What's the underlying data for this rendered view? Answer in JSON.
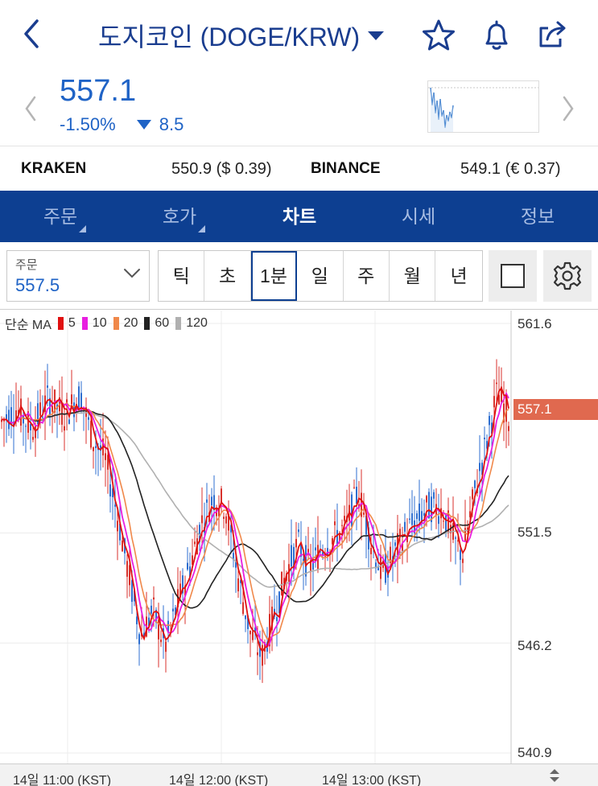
{
  "header": {
    "title": "도지코인 (DOGE/KRW)",
    "icons": [
      "back-arrow-icon",
      "star-icon",
      "bell-icon",
      "share-icon"
    ]
  },
  "price": {
    "current": "557.1",
    "change_pct": "-1.50%",
    "change_abs": "8.5",
    "color": "#1f63c6"
  },
  "exchanges": [
    {
      "name": "KRAKEN",
      "value": "550.9 ($ 0.39)"
    },
    {
      "name": "BINANCE",
      "value": "549.1 (€ 0.37)"
    }
  ],
  "tabs": [
    {
      "label": "주문",
      "active": false,
      "has_menu": true
    },
    {
      "label": "호가",
      "active": false,
      "has_menu": true
    },
    {
      "label": "차트",
      "active": true,
      "has_menu": false
    },
    {
      "label": "시세",
      "active": false,
      "has_menu": false
    },
    {
      "label": "정보",
      "active": false,
      "has_menu": false
    }
  ],
  "toolbar": {
    "order_label": "주문",
    "order_value": "557.5",
    "periods": [
      "틱",
      "초",
      "1분",
      "일",
      "주",
      "월",
      "년"
    ],
    "active_period": "1분"
  },
  "chart_data": {
    "type": "candlestick",
    "indicator_label": "단순 MA",
    "ma_series": [
      {
        "name": "5",
        "color": "#e01010"
      },
      {
        "name": "10",
        "color": "#e81ee0"
      },
      {
        "name": "20",
        "color": "#f0884a"
      },
      {
        "name": "60",
        "color": "#222222"
      },
      {
        "name": "120",
        "color": "#b0b0b0"
      }
    ],
    "y_ticks": [
      "561.6",
      "551.5",
      "546.2",
      "540.9"
    ],
    "ylim": [
      540.9,
      561.6
    ],
    "last_price_tag": "557.1",
    "x_ticks": [
      "14일 11:00 (KST)",
      "14일 12:00 (KST)",
      "14일 13:00 (KST)"
    ],
    "grid": true
  }
}
